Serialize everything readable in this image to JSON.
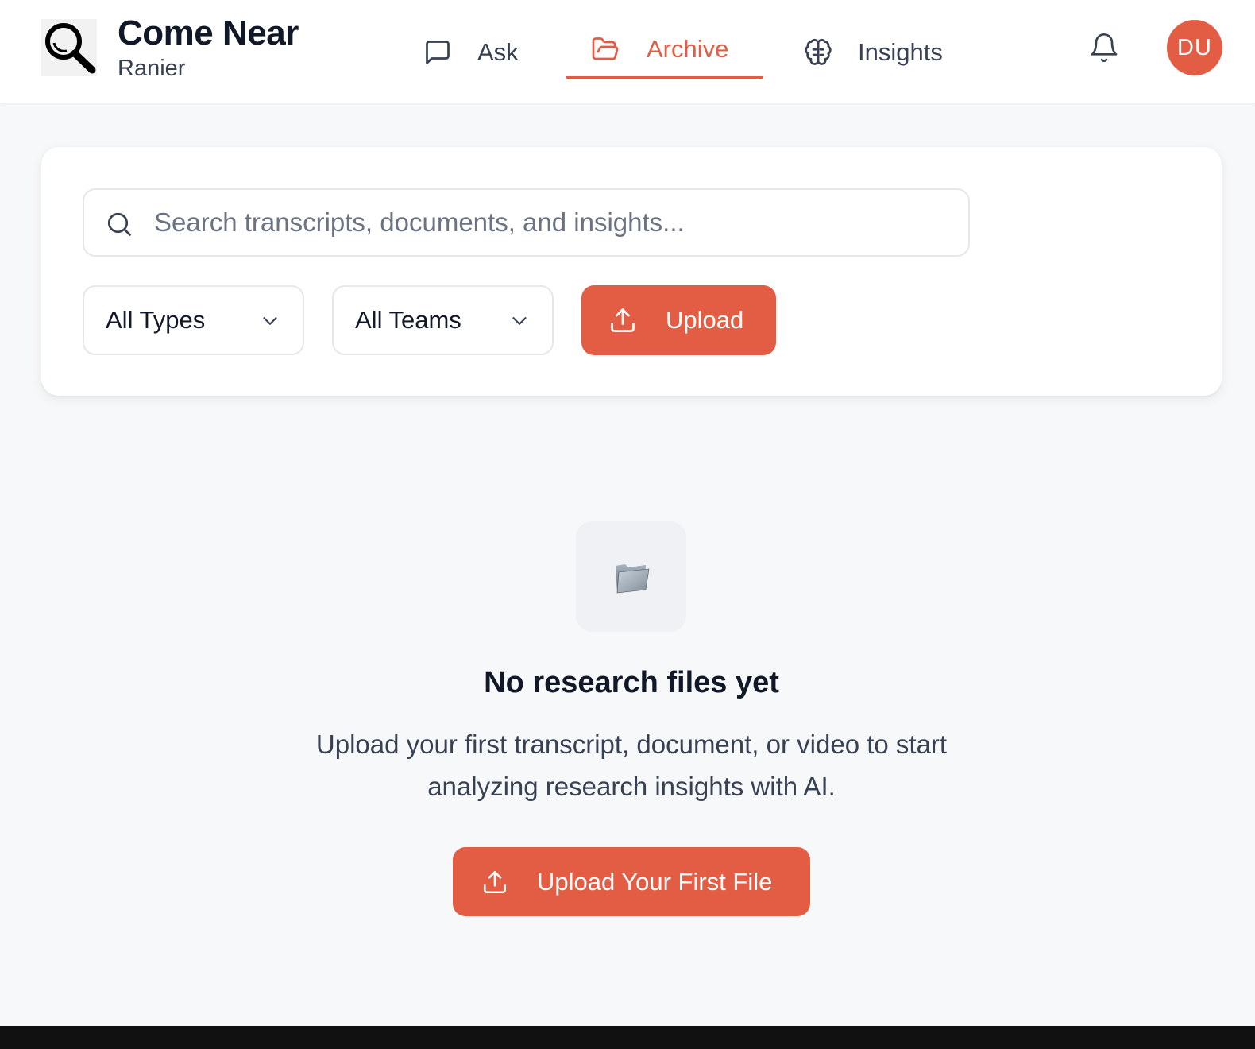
{
  "brand": {
    "title": "Come Near",
    "subtitle": "Ranier"
  },
  "nav": {
    "ask": "Ask",
    "archive": "Archive",
    "insights": "Insights",
    "active": "archive"
  },
  "user": {
    "initials": "DU"
  },
  "search": {
    "placeholder": "Search transcripts, documents, and insights...",
    "value": ""
  },
  "filters": {
    "types": "All Types",
    "teams": "All Teams"
  },
  "toolbar": {
    "upload_label": "Upload"
  },
  "empty_state": {
    "title": "No research files yet",
    "description_line1": "Upload your first transcript, document, or video to start",
    "description_line2": "analyzing research insights with AI.",
    "cta_label": "Upload Your First File"
  },
  "colors": {
    "accent": "#e35d44",
    "text": "#111827",
    "muted": "#374151",
    "background": "#f7f8fa"
  },
  "icons": {
    "logo": "magnifier-logo-icon",
    "ask": "message-square-icon",
    "archive": "folder-open-icon",
    "insights": "brain-icon",
    "notifications": "bell-icon",
    "search": "search-icon",
    "dropdown": "chevron-down-icon",
    "upload": "upload-icon",
    "empty": "folder-emoji-icon"
  }
}
